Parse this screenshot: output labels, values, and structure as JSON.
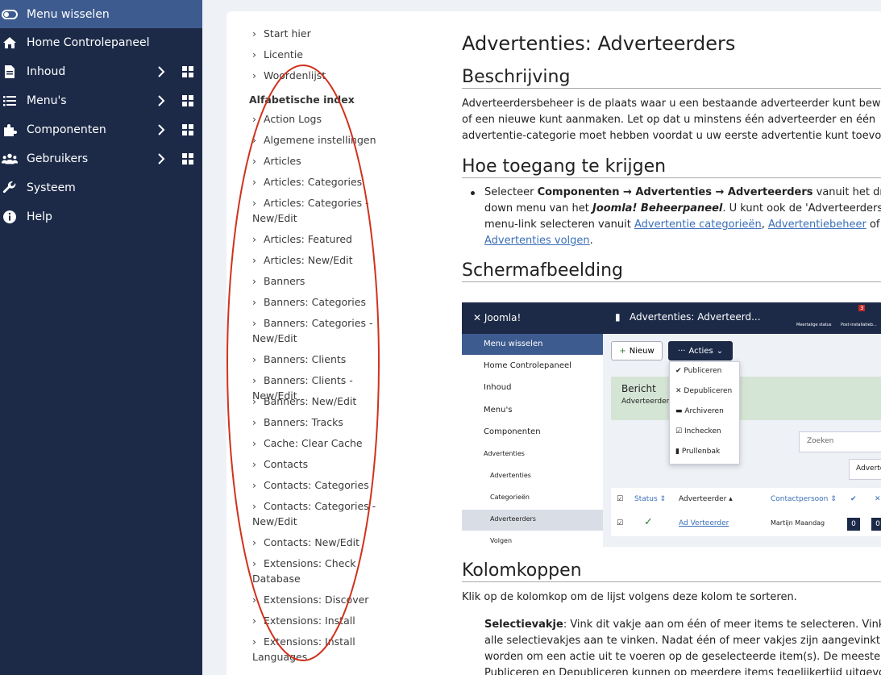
{
  "sidebar": {
    "items": [
      {
        "label": "Menu wisselen",
        "icon": "toggle-icon"
      },
      {
        "label": "Home Controlepaneel",
        "icon": "home-icon"
      },
      {
        "label": "Inhoud",
        "icon": "file-icon"
      },
      {
        "label": "Menu's",
        "icon": "list-icon"
      },
      {
        "label": "Componenten",
        "icon": "puzzle-icon"
      },
      {
        "label": "Gebruikers",
        "icon": "users-icon"
      },
      {
        "label": "Systeem",
        "icon": "wrench-icon"
      },
      {
        "label": "Help",
        "icon": "info-icon"
      }
    ]
  },
  "toc": {
    "top_links": [
      "Start hier",
      "Licentie",
      "Woordenlijst"
    ],
    "index_heading": "Alfabetische index",
    "index_links": [
      {
        "line1": "Action Logs",
        "line2": ""
      },
      {
        "line1": "Algemene instellingen",
        "line2": ""
      },
      {
        "line1": "Articles",
        "line2": ""
      },
      {
        "line1": "Articles: Categories",
        "line2": ""
      },
      {
        "line1": "Articles: Categories -",
        "line2": "New/Edit"
      },
      {
        "line1": "Articles: Featured",
        "line2": ""
      },
      {
        "line1": "Articles: New/Edit",
        "line2": ""
      },
      {
        "line1": "Banners",
        "line2": ""
      },
      {
        "line1": "Banners: Categories",
        "line2": ""
      },
      {
        "line1": "Banners: Categories -",
        "line2": "New/Edit"
      },
      {
        "line1": "Banners: Clients",
        "line2": ""
      },
      {
        "line1": "Banners: Clients - New/Edit",
        "line2": ""
      },
      {
        "line1": "Banners: New/Edit",
        "line2": ""
      },
      {
        "line1": "Banners: Tracks",
        "line2": ""
      },
      {
        "line1": "Cache: Clear Cache",
        "line2": ""
      },
      {
        "line1": "Contacts",
        "line2": ""
      },
      {
        "line1": "Contacts: Categories",
        "line2": ""
      },
      {
        "line1": "Contacts: Categories -",
        "line2": "New/Edit"
      },
      {
        "line1": "Contacts: New/Edit",
        "line2": ""
      },
      {
        "line1": "Extensions: Check",
        "line2": "Database"
      },
      {
        "line1": "Extensions: Discover",
        "line2": ""
      },
      {
        "line1": "Extensions: Install",
        "line2": ""
      },
      {
        "line1": "Extensions: Install",
        "line2": "Languages"
      }
    ]
  },
  "content": {
    "title": "Advertenties: Adverteerders",
    "sections": {
      "desc_heading": "Beschrijving",
      "desc_lines": [
        "Adverteerdersbeheer is de plaats waar u een bestaande adverteerder kunt bewerken",
        "of een nieuwe kunt aanmaken. Let op dat u minstens één adverteerder en één",
        "advertentie-categorie moet hebben voordat u uw eerste advertentie kunt toevoegen."
      ],
      "access_heading": "Hoe toegang te krijgen",
      "access_pre": "Selecteer ",
      "access_bold1": "Componenten → Advertenties → Adverteerders",
      "access_mid1": " vanuit het drop-",
      "access_line2_pre": "down menu van het ",
      "access_bold2": "Joomla! Beheerpaneel",
      "access_line2_post": ". U kunt ook de 'Adverteerders'",
      "access_line3_pre": "menu-link selecteren vanuit ",
      "access_link1": "Advertentie categorieën",
      "access_sep": ", ",
      "access_link2": "Advertentiebeheer",
      "access_or": " of",
      "access_link3": "Advertenties volgen",
      "access_end": ".",
      "screenshot_heading": "Schermafbeelding",
      "columns_heading": "Kolomkoppen",
      "columns_intro": "Klik op de kolomkop om de lijst volgens deze kolom te sorteren.",
      "bullet_bold": "Selectievakje",
      "bullet_lines": [
        ": Vink dit vakje aan om één of meer items te selecteren. Vink het",
        "alle selectievakjes aan te vinken. Nadat één of meer vakjes zijn aangevinkt kan",
        "worden om een actie uit te voeren op de geselecteerde item(s). De meeste ac",
        "Publiceren en Depubliceren kunnen op meerdere items tegelijkertijd uitgevoe"
      ]
    }
  },
  "screenshot": {
    "logo": "Joomla!",
    "page_title": "Advertenties: Adverteerd...",
    "header_right": [
      "Meertalige status",
      "Post-installatieb..."
    ],
    "notif_count": "3",
    "menu_toggle": "Menu wisselen",
    "side_items": [
      "Home Controlepaneel",
      "Inhoud",
      "Menu's",
      "Componenten"
    ],
    "side_sub": [
      "Advertenties",
      "Advertenties",
      "Categorieën",
      "Adverteerders",
      "Volgen"
    ],
    "btn_new": "Nieuw",
    "btn_actions": "Acties",
    "actions": [
      "Publiceren",
      "Depubliceren",
      "Archiveren",
      "Inchecken",
      "Prullenbak"
    ],
    "msg_title": "Bericht",
    "msg_text": "Adverteerder",
    "search_placeholder": "Zoeken",
    "filter_label": "Adverte",
    "col_status": "Status ⇕",
    "col_advertiser": "Adverteerder ▴",
    "col_contact": "Contactpersoon ⇕",
    "row_name": "Ad Verteerder",
    "row_contact": "Martijn Maandag",
    "row_count": "0",
    "row_count2": "0"
  }
}
